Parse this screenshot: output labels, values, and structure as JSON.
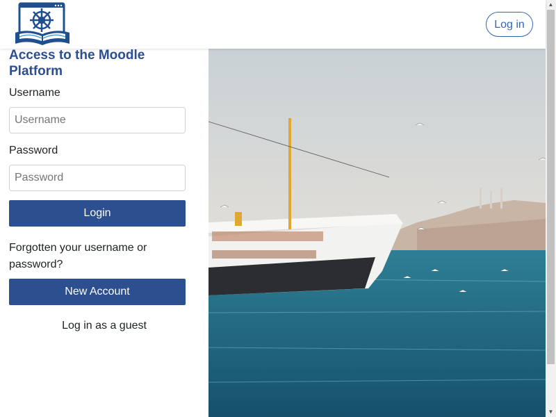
{
  "header": {
    "login_button": "Log in"
  },
  "login": {
    "title": "Access to the Moodle Platform",
    "username_label": "Username",
    "username_placeholder": "Username",
    "password_label": "Password",
    "password_placeholder": "Password",
    "login_button": "Login",
    "forgot_text": "Forgotten your username or password?",
    "new_account_button": "New Account",
    "guest_button": "Log in as a guest"
  },
  "colors": {
    "brand": "#2b4f8f",
    "link": "#3066b8"
  },
  "icons": {
    "logo": "ship-wheel-book-logo",
    "scroll_up": "arrow-up-icon",
    "scroll_down": "arrow-down-icon"
  }
}
